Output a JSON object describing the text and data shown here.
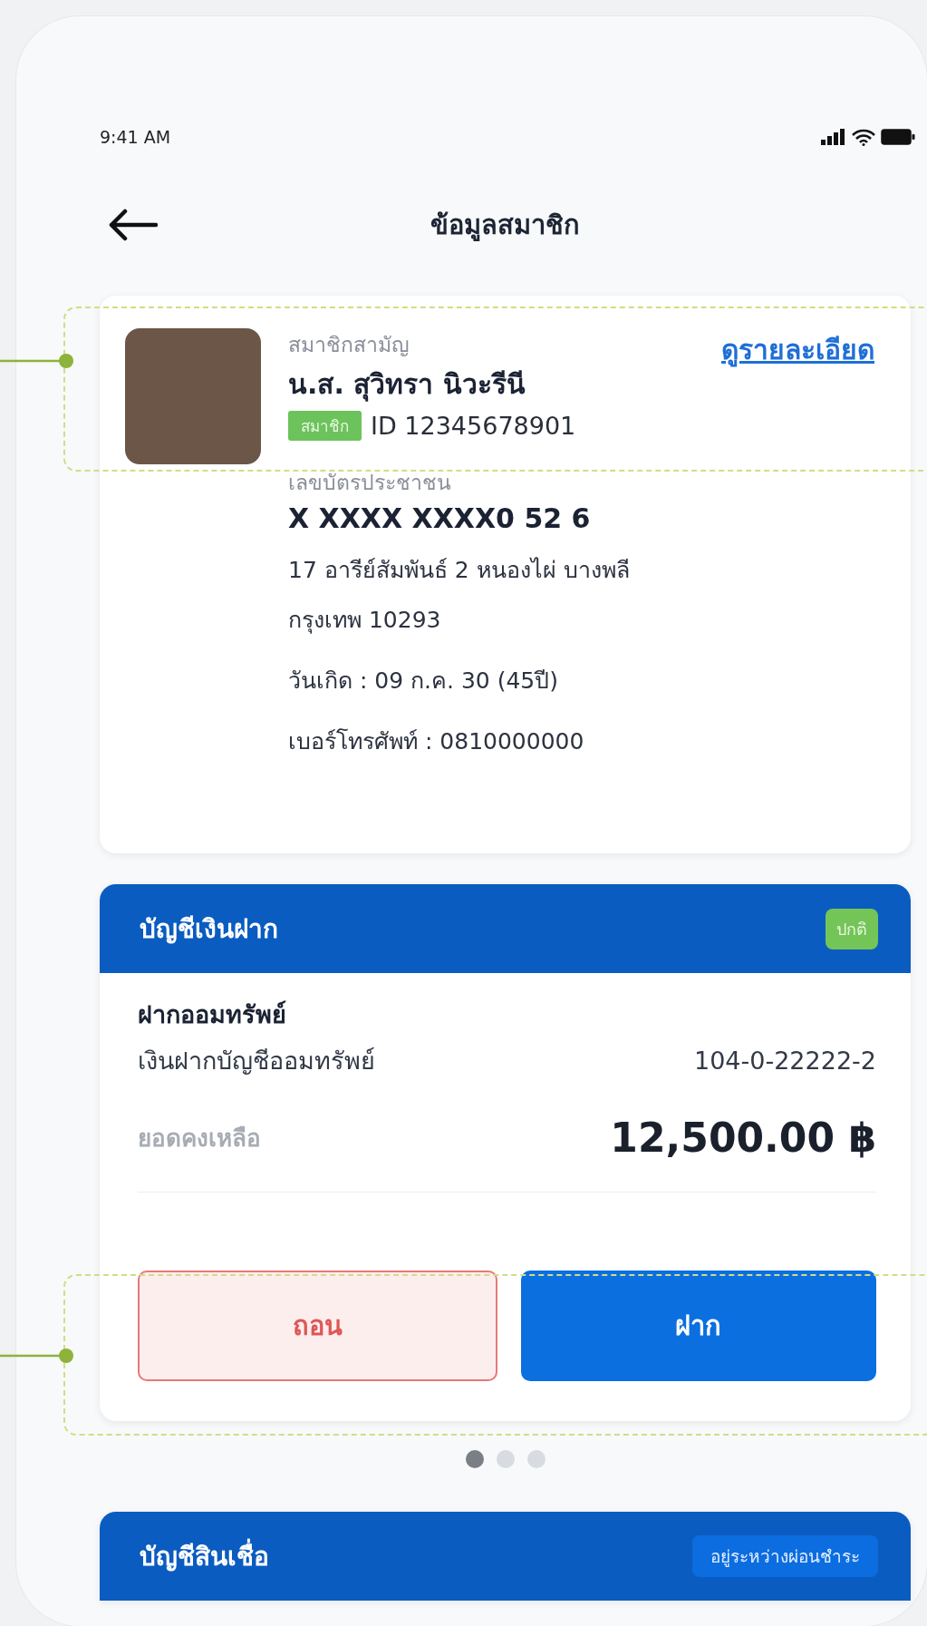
{
  "status_bar": {
    "time": "9:41 AM"
  },
  "header": {
    "title": "ข้อมูลสมาชิก"
  },
  "member": {
    "type": "สมาชิกสามัญ",
    "name": "น.ส. สุวิทรา นิวะรีนี",
    "badge": "สมาชิก",
    "id": "ID 12345678901",
    "details_link": "ดูรายละเอียด",
    "id_card_label": "เลขบัตรประชาชน",
    "id_card_number": "X XXXX XXXX0 52 6",
    "address": "17 อารีย์สัมพันธ์ 2 หนองไผ่ บางพลี\nกรุงเทพ 10293",
    "birth": "วันเกิด : 09 ก.ค. 30 (45ปี)",
    "phone": "เบอร์โทรศัพท์ : 0810000000"
  },
  "deposit": {
    "title": "บัญชีเงินฝาก",
    "status": "ปกติ",
    "type": "ฝากออมทรัพย์",
    "account_name": "เงินฝากบัญชีออมทรัพย์",
    "account_number": "104-0-22222-2",
    "balance_label": "ยอดคงเหลือ",
    "balance": "12,500.00 ฿",
    "buttons": [
      {
        "label": "ถอน",
        "kind": "outline"
      },
      {
        "label": "ฝาก",
        "kind": "primary"
      }
    ]
  },
  "pager": {
    "dots": [
      {
        "selected": true
      },
      {
        "selected": false
      },
      {
        "selected": false
      }
    ]
  },
  "loan": {
    "title": "บัญชีสินเชื่อ",
    "status": "อยู่ระหว่างผ่อนชำระ"
  }
}
